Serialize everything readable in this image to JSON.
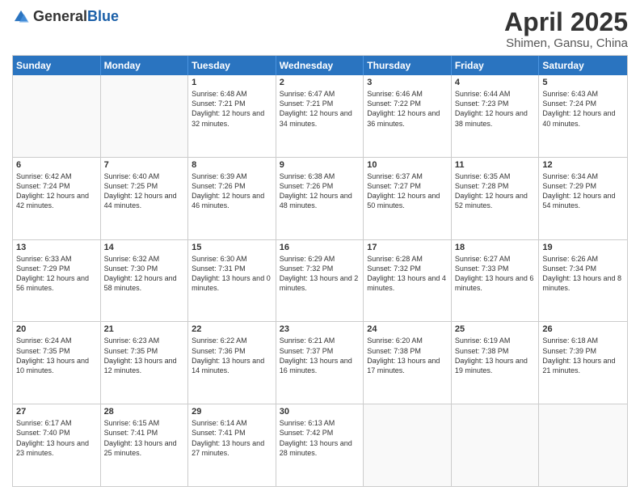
{
  "logo": {
    "general": "General",
    "blue": "Blue"
  },
  "title": {
    "month": "April 2025",
    "location": "Shimen, Gansu, China"
  },
  "weekdays": [
    "Sunday",
    "Monday",
    "Tuesday",
    "Wednesday",
    "Thursday",
    "Friday",
    "Saturday"
  ],
  "weeks": [
    [
      {
        "day": "",
        "empty": true
      },
      {
        "day": "",
        "empty": true
      },
      {
        "day": "1",
        "sunrise": "Sunrise: 6:48 AM",
        "sunset": "Sunset: 7:21 PM",
        "daylight": "Daylight: 12 hours and 32 minutes."
      },
      {
        "day": "2",
        "sunrise": "Sunrise: 6:47 AM",
        "sunset": "Sunset: 7:21 PM",
        "daylight": "Daylight: 12 hours and 34 minutes."
      },
      {
        "day": "3",
        "sunrise": "Sunrise: 6:46 AM",
        "sunset": "Sunset: 7:22 PM",
        "daylight": "Daylight: 12 hours and 36 minutes."
      },
      {
        "day": "4",
        "sunrise": "Sunrise: 6:44 AM",
        "sunset": "Sunset: 7:23 PM",
        "daylight": "Daylight: 12 hours and 38 minutes."
      },
      {
        "day": "5",
        "sunrise": "Sunrise: 6:43 AM",
        "sunset": "Sunset: 7:24 PM",
        "daylight": "Daylight: 12 hours and 40 minutes."
      }
    ],
    [
      {
        "day": "6",
        "sunrise": "Sunrise: 6:42 AM",
        "sunset": "Sunset: 7:24 PM",
        "daylight": "Daylight: 12 hours and 42 minutes."
      },
      {
        "day": "7",
        "sunrise": "Sunrise: 6:40 AM",
        "sunset": "Sunset: 7:25 PM",
        "daylight": "Daylight: 12 hours and 44 minutes."
      },
      {
        "day": "8",
        "sunrise": "Sunrise: 6:39 AM",
        "sunset": "Sunset: 7:26 PM",
        "daylight": "Daylight: 12 hours and 46 minutes."
      },
      {
        "day": "9",
        "sunrise": "Sunrise: 6:38 AM",
        "sunset": "Sunset: 7:26 PM",
        "daylight": "Daylight: 12 hours and 48 minutes."
      },
      {
        "day": "10",
        "sunrise": "Sunrise: 6:37 AM",
        "sunset": "Sunset: 7:27 PM",
        "daylight": "Daylight: 12 hours and 50 minutes."
      },
      {
        "day": "11",
        "sunrise": "Sunrise: 6:35 AM",
        "sunset": "Sunset: 7:28 PM",
        "daylight": "Daylight: 12 hours and 52 minutes."
      },
      {
        "day": "12",
        "sunrise": "Sunrise: 6:34 AM",
        "sunset": "Sunset: 7:29 PM",
        "daylight": "Daylight: 12 hours and 54 minutes."
      }
    ],
    [
      {
        "day": "13",
        "sunrise": "Sunrise: 6:33 AM",
        "sunset": "Sunset: 7:29 PM",
        "daylight": "Daylight: 12 hours and 56 minutes."
      },
      {
        "day": "14",
        "sunrise": "Sunrise: 6:32 AM",
        "sunset": "Sunset: 7:30 PM",
        "daylight": "Daylight: 12 hours and 58 minutes."
      },
      {
        "day": "15",
        "sunrise": "Sunrise: 6:30 AM",
        "sunset": "Sunset: 7:31 PM",
        "daylight": "Daylight: 13 hours and 0 minutes."
      },
      {
        "day": "16",
        "sunrise": "Sunrise: 6:29 AM",
        "sunset": "Sunset: 7:32 PM",
        "daylight": "Daylight: 13 hours and 2 minutes."
      },
      {
        "day": "17",
        "sunrise": "Sunrise: 6:28 AM",
        "sunset": "Sunset: 7:32 PM",
        "daylight": "Daylight: 13 hours and 4 minutes."
      },
      {
        "day": "18",
        "sunrise": "Sunrise: 6:27 AM",
        "sunset": "Sunset: 7:33 PM",
        "daylight": "Daylight: 13 hours and 6 minutes."
      },
      {
        "day": "19",
        "sunrise": "Sunrise: 6:26 AM",
        "sunset": "Sunset: 7:34 PM",
        "daylight": "Daylight: 13 hours and 8 minutes."
      }
    ],
    [
      {
        "day": "20",
        "sunrise": "Sunrise: 6:24 AM",
        "sunset": "Sunset: 7:35 PM",
        "daylight": "Daylight: 13 hours and 10 minutes."
      },
      {
        "day": "21",
        "sunrise": "Sunrise: 6:23 AM",
        "sunset": "Sunset: 7:35 PM",
        "daylight": "Daylight: 13 hours and 12 minutes."
      },
      {
        "day": "22",
        "sunrise": "Sunrise: 6:22 AM",
        "sunset": "Sunset: 7:36 PM",
        "daylight": "Daylight: 13 hours and 14 minutes."
      },
      {
        "day": "23",
        "sunrise": "Sunrise: 6:21 AM",
        "sunset": "Sunset: 7:37 PM",
        "daylight": "Daylight: 13 hours and 16 minutes."
      },
      {
        "day": "24",
        "sunrise": "Sunrise: 6:20 AM",
        "sunset": "Sunset: 7:38 PM",
        "daylight": "Daylight: 13 hours and 17 minutes."
      },
      {
        "day": "25",
        "sunrise": "Sunrise: 6:19 AM",
        "sunset": "Sunset: 7:38 PM",
        "daylight": "Daylight: 13 hours and 19 minutes."
      },
      {
        "day": "26",
        "sunrise": "Sunrise: 6:18 AM",
        "sunset": "Sunset: 7:39 PM",
        "daylight": "Daylight: 13 hours and 21 minutes."
      }
    ],
    [
      {
        "day": "27",
        "sunrise": "Sunrise: 6:17 AM",
        "sunset": "Sunset: 7:40 PM",
        "daylight": "Daylight: 13 hours and 23 minutes."
      },
      {
        "day": "28",
        "sunrise": "Sunrise: 6:15 AM",
        "sunset": "Sunset: 7:41 PM",
        "daylight": "Daylight: 13 hours and 25 minutes."
      },
      {
        "day": "29",
        "sunrise": "Sunrise: 6:14 AM",
        "sunset": "Sunset: 7:41 PM",
        "daylight": "Daylight: 13 hours and 27 minutes."
      },
      {
        "day": "30",
        "sunrise": "Sunrise: 6:13 AM",
        "sunset": "Sunset: 7:42 PM",
        "daylight": "Daylight: 13 hours and 28 minutes."
      },
      {
        "day": "",
        "empty": true
      },
      {
        "day": "",
        "empty": true
      },
      {
        "day": "",
        "empty": true
      }
    ]
  ]
}
